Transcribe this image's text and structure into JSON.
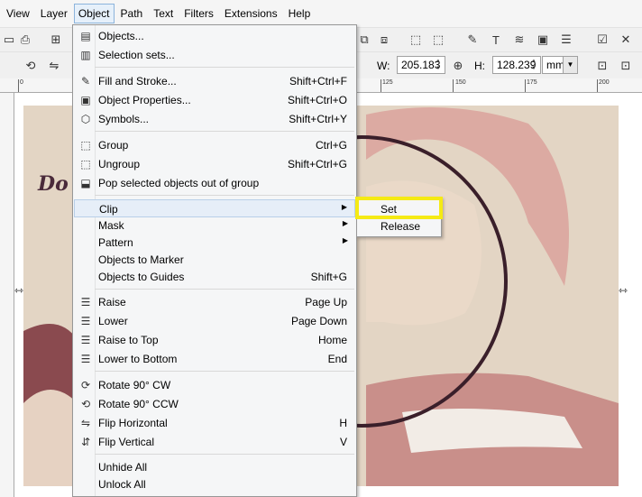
{
  "menubar": {
    "items": [
      "View",
      "Layer",
      "Object",
      "Path",
      "Text",
      "Filters",
      "Extensions",
      "Help"
    ],
    "active_index": 2
  },
  "toolbar2": {
    "w_label": "W:",
    "w_value": "205.183",
    "h_label": "H:",
    "h_value": "128.239",
    "unit": "mm"
  },
  "ruler": {
    "labels": [
      "0",
      "125",
      "150",
      "175",
      "200"
    ]
  },
  "canvas": {
    "artwork_text": "Do"
  },
  "object_menu": {
    "items": [
      {
        "label": "Objects...",
        "shortcut": "",
        "icon": "objects-icon"
      },
      {
        "label": "Selection sets...",
        "shortcut": "",
        "icon": "selection-sets-icon"
      },
      {
        "label": "Fill and Stroke...",
        "shortcut": "Shift+Ctrl+F",
        "icon": "fill-stroke-icon"
      },
      {
        "label": "Object Properties...",
        "shortcut": "Shift+Ctrl+O",
        "icon": "object-properties-icon"
      },
      {
        "label": "Symbols...",
        "shortcut": "Shift+Ctrl+Y",
        "icon": "symbols-icon"
      },
      {
        "label": "Group",
        "shortcut": "Ctrl+G",
        "icon": "group-icon"
      },
      {
        "label": "Ungroup",
        "shortcut": "Shift+Ctrl+G",
        "icon": "ungroup-icon"
      },
      {
        "label": "Pop selected objects out of group",
        "shortcut": "",
        "icon": "pop-out-icon"
      },
      {
        "label": "Clip",
        "shortcut": "",
        "icon": "",
        "submenu": true
      },
      {
        "label": "Mask",
        "shortcut": "",
        "icon": "",
        "submenu": true
      },
      {
        "label": "Pattern",
        "shortcut": "",
        "icon": "",
        "submenu": true
      },
      {
        "label": "Objects to Marker",
        "shortcut": "",
        "icon": ""
      },
      {
        "label": "Objects to Guides",
        "shortcut": "Shift+G",
        "icon": ""
      },
      {
        "label": "Raise",
        "shortcut": "Page Up",
        "icon": "raise-icon"
      },
      {
        "label": "Lower",
        "shortcut": "Page Down",
        "icon": "lower-icon"
      },
      {
        "label": "Raise to Top",
        "shortcut": "Home",
        "icon": "raise-top-icon"
      },
      {
        "label": "Lower to Bottom",
        "shortcut": "End",
        "icon": "lower-bottom-icon"
      },
      {
        "label": "Rotate 90° CW",
        "shortcut": "",
        "icon": "rotate-cw-icon"
      },
      {
        "label": "Rotate 90° CCW",
        "shortcut": "",
        "icon": "rotate-ccw-icon"
      },
      {
        "label": "Flip Horizontal",
        "shortcut": "H",
        "icon": "flip-horizontal-icon"
      },
      {
        "label": "Flip Vertical",
        "shortcut": "V",
        "icon": "flip-vertical-icon"
      },
      {
        "label": "Unhide All",
        "shortcut": "",
        "icon": ""
      },
      {
        "label": "Unlock All",
        "shortcut": "",
        "icon": ""
      }
    ]
  },
  "clip_submenu": {
    "items": [
      "Set",
      "Release"
    ]
  },
  "colors": {
    "highlight": "#f5ea14",
    "menu_hover": "#e6eef8"
  }
}
